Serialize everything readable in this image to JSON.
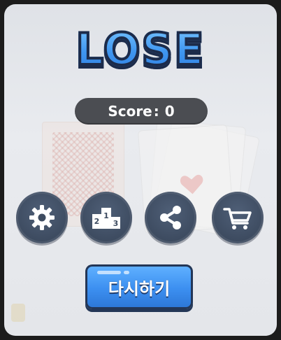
{
  "result": {
    "title": "LOSE",
    "score_label": "Score",
    "score_separator": ":",
    "score_value": "0"
  },
  "buttons": {
    "settings_icon": "gear-icon",
    "ranking_icon": "podium-icon",
    "share_icon": "share-icon",
    "shop_icon": "cart-icon",
    "retry_label": "다시하기"
  },
  "colors": {
    "title_blue": "#3f96f0",
    "icon_button": "#3d4b60",
    "retry_blue": "#3c8ff0",
    "score_pill": "#4b4d52"
  }
}
